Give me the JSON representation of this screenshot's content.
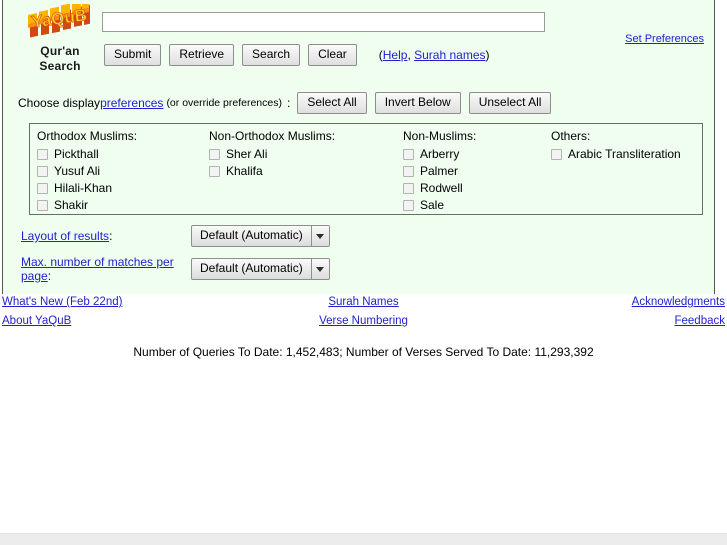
{
  "brand": {
    "logo_text": "YaQuB",
    "title_line1": "Qur'an",
    "title_line2": "Search",
    "logo_face_color": "#ffb400",
    "logo_shadow_color": "#d24a10"
  },
  "search": {
    "value": "",
    "placeholder": ""
  },
  "buttons": {
    "submit": "Submit",
    "retrieve": "Retrieve",
    "search": "Search",
    "clear": "Clear"
  },
  "help_note": {
    "open_paren": "(",
    "help_label": "Help",
    "comma": ", ",
    "surah_names_label": "Surah names",
    "close_paren": ")"
  },
  "set_preferences_label": "Set Preferences",
  "prefs_line": {
    "lead": "Choose display ",
    "preferences_link": "preferences",
    "paren_text": "(or override preferences)",
    "colon": ":",
    "select_all": "Select All",
    "invert_below": "Invert Below",
    "unselect_all": "Unselect All"
  },
  "translators": [
    {
      "heading": "Orthodox Muslims:",
      "items": [
        {
          "label": "Pickthall",
          "checked": false
        },
        {
          "label": "Yusuf Ali",
          "checked": false
        },
        {
          "label": "Hilali-Khan",
          "checked": false
        },
        {
          "label": "Shakir",
          "checked": false
        }
      ]
    },
    {
      "heading": "Non-Orthodox Muslims:",
      "items": [
        {
          "label": "Sher Ali",
          "checked": false
        },
        {
          "label": "Khalifa",
          "checked": false
        }
      ]
    },
    {
      "heading": "Non-Muslims:",
      "items": [
        {
          "label": "Arberry",
          "checked": false
        },
        {
          "label": "Palmer",
          "checked": false
        },
        {
          "label": "Rodwell",
          "checked": false
        },
        {
          "label": "Sale",
          "checked": false
        }
      ]
    },
    {
      "heading": "Others:",
      "items": [
        {
          "label": "Arabic Transliteration",
          "checked": false
        }
      ]
    }
  ],
  "options": {
    "layout_label": "Layout of results",
    "layout_colon": ":",
    "layout_value": "Default (Automatic)",
    "maxmatches_label": "Max. number of matches per page",
    "maxmatches_colon": ":",
    "maxmatches_value": "Default (Automatic)"
  },
  "footer": {
    "row1": {
      "left": "What's New (Feb 22nd)",
      "center": "Surah Names",
      "right": "Acknowledgments"
    },
    "row2": {
      "left": "About YaQuB",
      "center": "Verse Numbering",
      "right": "Feedback"
    },
    "counter": "Number of Queries To Date: 1,452,483; Number of Verses Served To Date: 11,293,392"
  },
  "colors": {
    "page_background": "#effeef",
    "link": "#2222cc",
    "box_border": "#657065"
  }
}
